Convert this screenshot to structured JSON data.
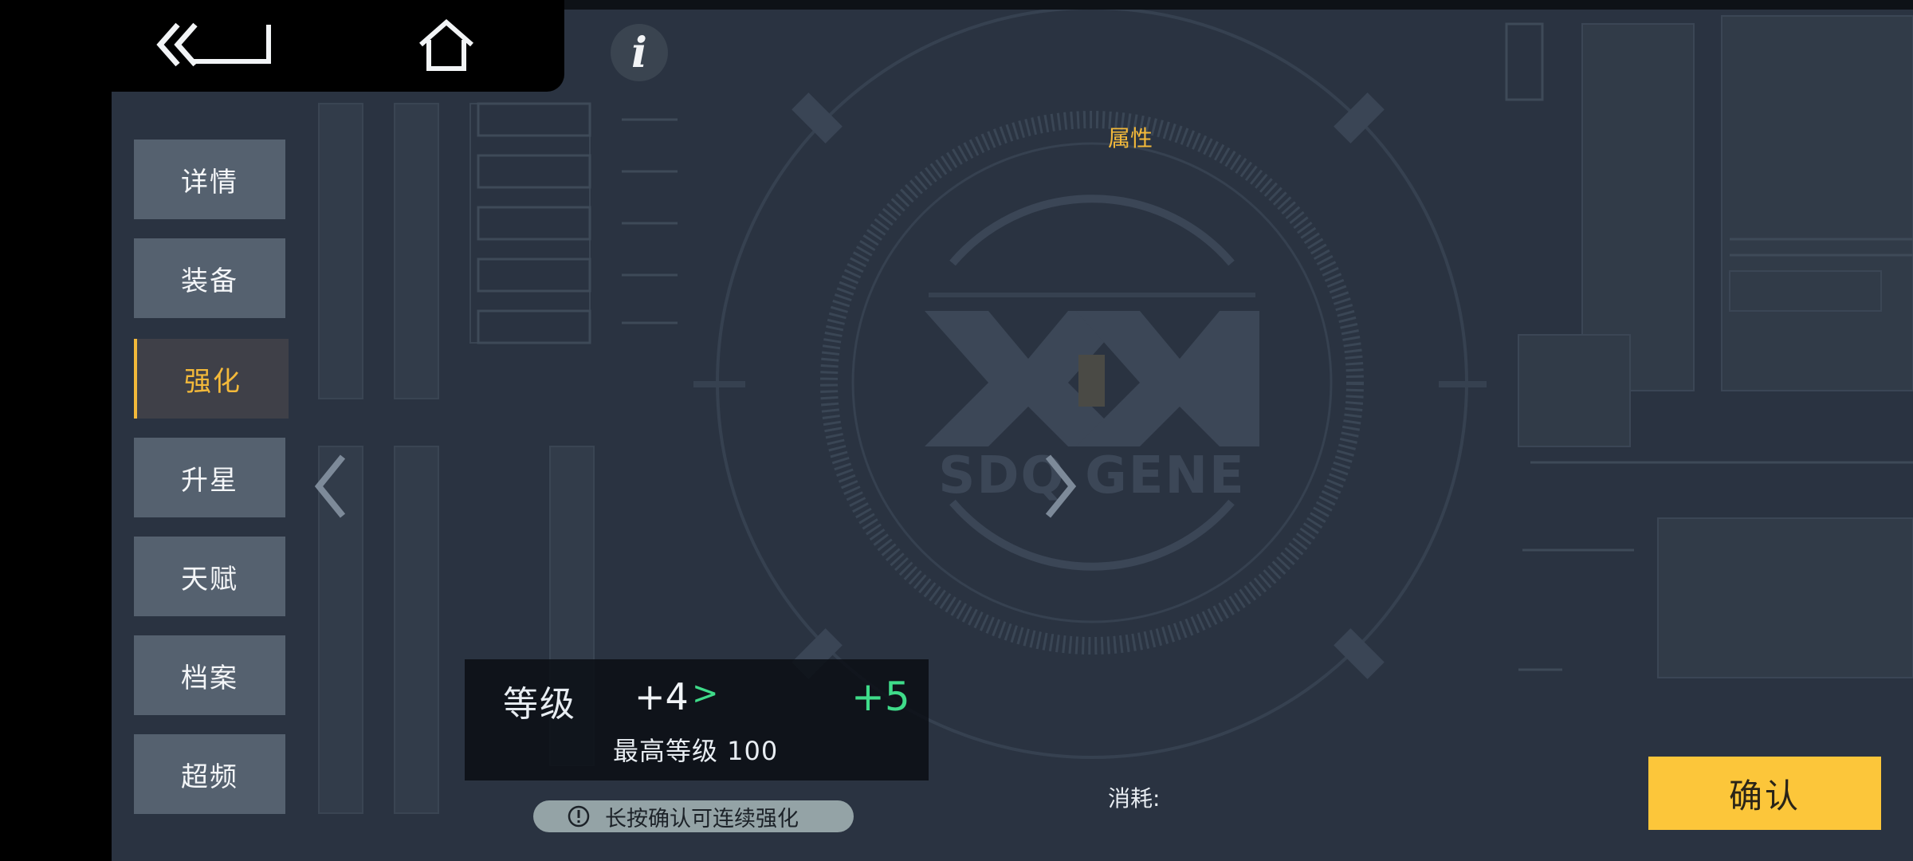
{
  "nav": {
    "back_icon": "back-double-chevron-icon",
    "home_icon": "home-icon",
    "info_label": "i"
  },
  "sidebar": {
    "items": [
      {
        "label": "详情"
      },
      {
        "label": "装备"
      },
      {
        "label": "强化"
      },
      {
        "label": "升星"
      },
      {
        "label": "天赋"
      },
      {
        "label": "档案"
      },
      {
        "label": "超频"
      }
    ],
    "active_index": 2
  },
  "emblem": {
    "text": "SDQ GENE"
  },
  "attributes_label": "属性",
  "level": {
    "title": "等级",
    "current": "+4",
    "arrow": ">",
    "next": "+5",
    "max_label": "最高等级 100"
  },
  "hint": {
    "icon": "exclamation-circle-icon",
    "text": "长按确认可连续强化"
  },
  "cost_label": "消耗:",
  "confirm_label": "确认",
  "colors": {
    "accent": "#f3b93a",
    "confirm": "#fcc63a",
    "increase": "#3fdc8a",
    "background": "#2a3341"
  }
}
